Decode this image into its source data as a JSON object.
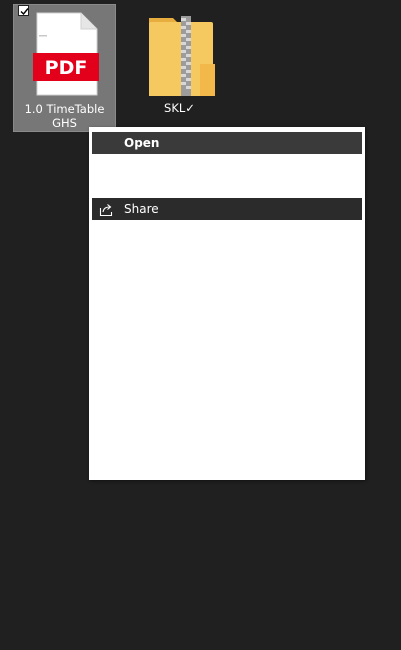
{
  "desktop": {
    "files": [
      {
        "name": "1.0 TimeTable GHS",
        "type": "pdf",
        "icon_text": "PDF",
        "selected": true,
        "checked": true
      },
      {
        "name": "SKL✓",
        "type": "zip-folder",
        "selected": false
      }
    ]
  },
  "context_menu": {
    "items": [
      {
        "label": "Open",
        "icon": "none",
        "default": true
      },
      {
        "label": "Share",
        "icon": "share-icon"
      }
    ]
  },
  "colors": {
    "background": "#202020",
    "selection": "#777777",
    "menu_background": "#ffffff",
    "menu_item_highlight": "#2b2b2b",
    "pdf_red": "#e2001a",
    "folder_yellow": "#f6c860"
  }
}
